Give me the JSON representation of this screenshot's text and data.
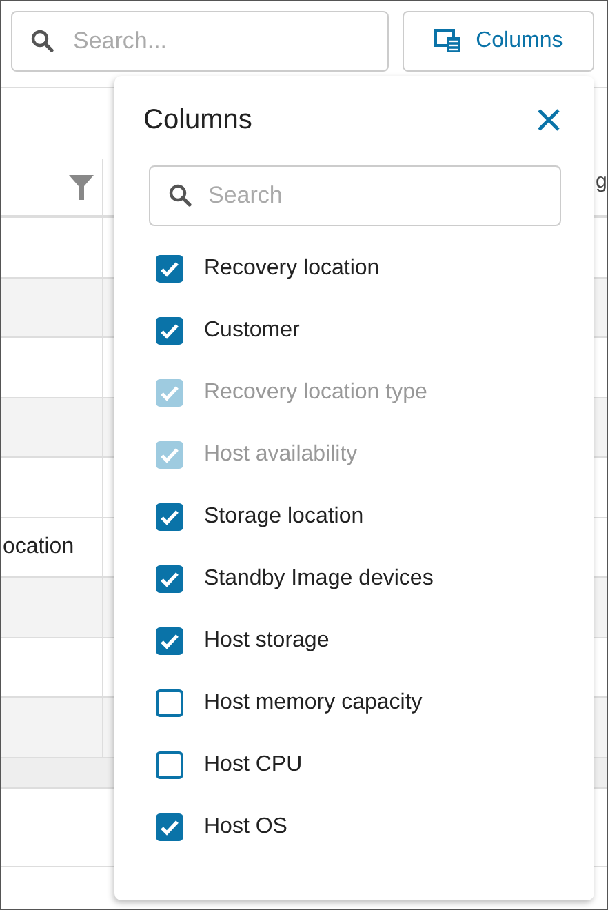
{
  "toolbar": {
    "search": {
      "placeholder": "Search..."
    },
    "columns_button": {
      "label": "Columns"
    }
  },
  "table": {
    "columns": [
      {
        "filter": true
      },
      {
        "heading": "g"
      }
    ],
    "rows": [
      {
        "shaded": false
      },
      {
        "shaded": true
      },
      {
        "shaded": false
      },
      {
        "shaded": true
      },
      {
        "shaded": false
      },
      {
        "shaded": false,
        "cell_1": "ocation"
      },
      {
        "shaded": true
      },
      {
        "shaded": false
      },
      {
        "shaded": true
      }
    ]
  },
  "columns_popup": {
    "title": "Columns",
    "search": {
      "placeholder": "Search"
    },
    "items": [
      {
        "label": "Recovery location",
        "checked": true,
        "disabled": false
      },
      {
        "label": "Customer",
        "checked": true,
        "disabled": false
      },
      {
        "label": "Recovery location type",
        "checked": true,
        "disabled": true
      },
      {
        "label": "Host availability",
        "checked": true,
        "disabled": true
      },
      {
        "label": "Storage location",
        "checked": true,
        "disabled": false
      },
      {
        "label": "Standby Image devices",
        "checked": true,
        "disabled": false
      },
      {
        "label": "Host storage",
        "checked": true,
        "disabled": false
      },
      {
        "label": "Host memory capacity",
        "checked": false,
        "disabled": false
      },
      {
        "label": "Host CPU",
        "checked": false,
        "disabled": false
      },
      {
        "label": "Host OS",
        "checked": true,
        "disabled": false
      }
    ]
  }
}
